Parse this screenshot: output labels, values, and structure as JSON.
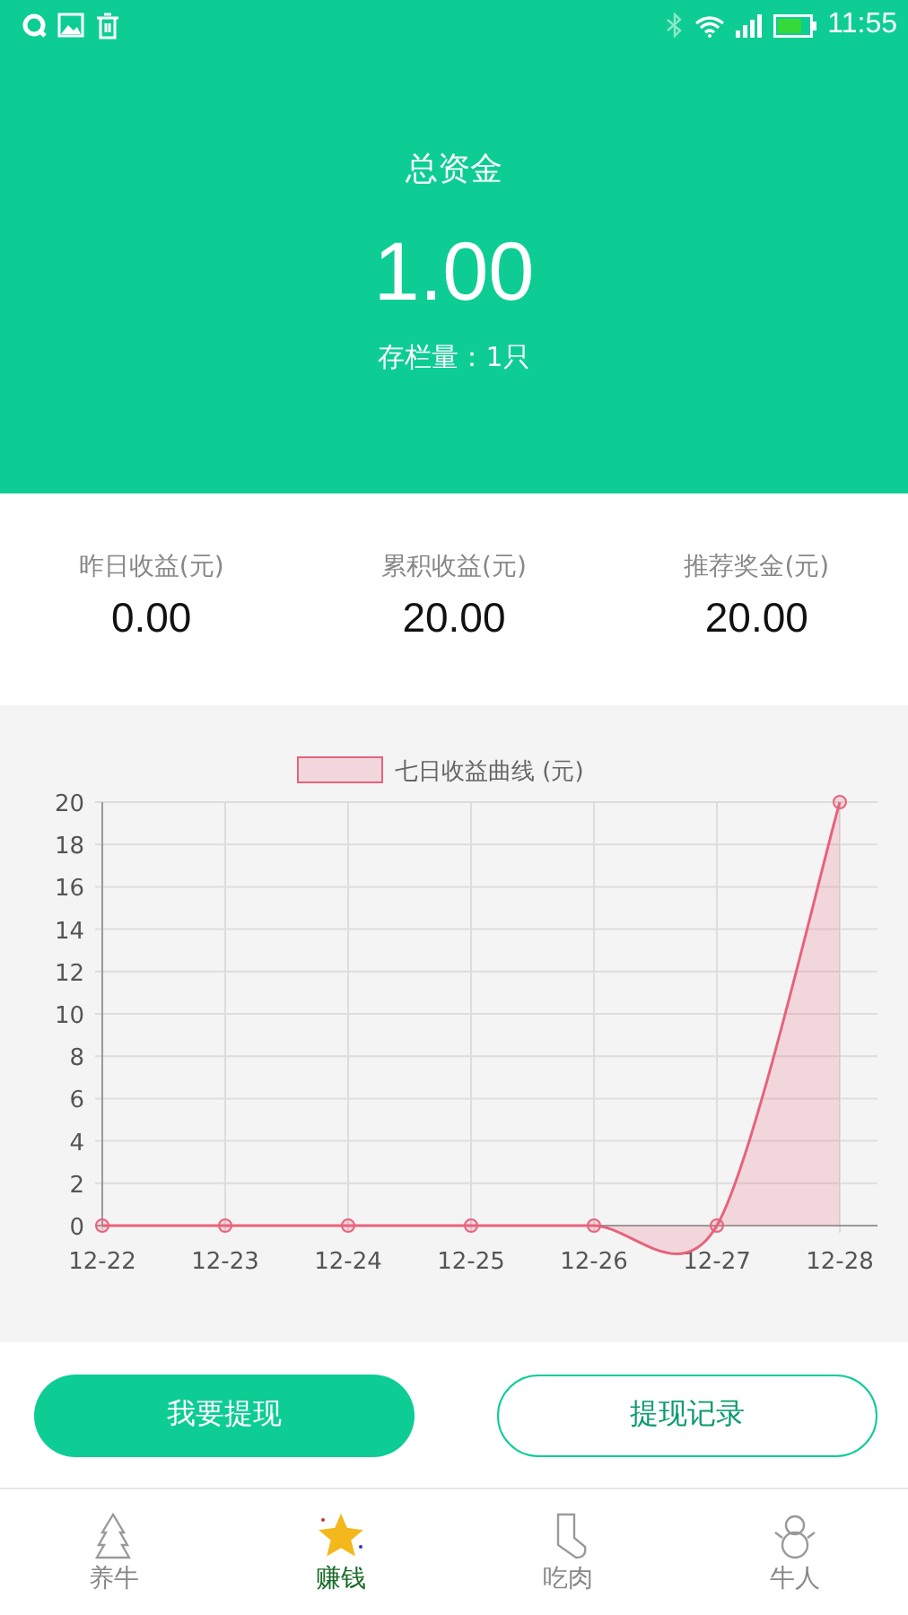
{
  "status_bar": {
    "time": "11:55"
  },
  "header": {
    "title": "总资金",
    "amount": "1.00",
    "stock": "存栏量：1只"
  },
  "stats": [
    {
      "label": "昨日收益(元)",
      "value": "0.00"
    },
    {
      "label": "累积收益(元)",
      "value": "20.00"
    },
    {
      "label": "推荐奖金(元)",
      "value": "20.00"
    }
  ],
  "chart": {
    "chart_data": {
      "type": "area",
      "categories": [
        "12-22",
        "12-23",
        "12-24",
        "12-25",
        "12-26",
        "12-27",
        "12-28"
      ],
      "series": [
        {
          "name": "七日收益曲线 (元)",
          "color": "#e8627c",
          "values": [
            0,
            0,
            0,
            0,
            0,
            0,
            20
          ]
        }
      ],
      "grid": true,
      "ylim": [
        0,
        20
      ],
      "yticks": [
        0,
        2,
        4,
        6,
        8,
        10,
        12,
        14,
        16,
        18,
        20
      ]
    }
  },
  "buttons": [
    {
      "label": "我要提现",
      "kind": "primary"
    },
    {
      "label": "提现记录",
      "kind": "outline"
    }
  ],
  "nav": [
    {
      "label": "养牛",
      "kind": "tree",
      "selected": false
    },
    {
      "label": "赚钱",
      "kind": "star",
      "selected": true
    },
    {
      "label": "吃肉",
      "kind": "sock",
      "selected": false
    },
    {
      "label": "牛人",
      "kind": "snowman",
      "selected": false
    }
  ]
}
